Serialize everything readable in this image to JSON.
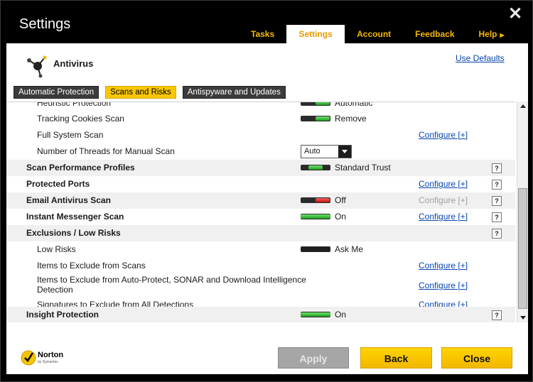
{
  "window": {
    "title": "Settings"
  },
  "topnav": {
    "tabs": [
      {
        "label": "Tasks"
      },
      {
        "label": "Settings"
      },
      {
        "label": "Account"
      },
      {
        "label": "Feedback"
      },
      {
        "label": "Help"
      }
    ],
    "active": "Settings"
  },
  "header": {
    "section": "Antivirus",
    "use_defaults": "Use Defaults",
    "logo_icon": "antivirus-molecule-icon"
  },
  "subtabs": [
    {
      "label": "Automatic Protection"
    },
    {
      "label": "Scans and Risks"
    },
    {
      "label": "Antispyware and Updates"
    }
  ],
  "rows": [
    {
      "label": "Heuristic Protection",
      "value": "Automatic"
    },
    {
      "label": "Tracking Cookies Scan",
      "value": "Remove"
    },
    {
      "label": "Full System Scan",
      "configure": "Configure [+]"
    },
    {
      "label": "Number of Threads for Manual Scan",
      "select": "Auto"
    },
    {
      "label": "Scan Performance Profiles",
      "value": "Standard Trust",
      "help": "?"
    },
    {
      "label": "Protected Ports",
      "configure": "Configure [+]",
      "help": "?"
    },
    {
      "label": "Email Antivirus Scan",
      "value": "Off",
      "configure": "Configure [+]",
      "help": "?"
    },
    {
      "label": "Instant Messenger Scan",
      "value": "On",
      "configure": "Configure [+]",
      "help": "?"
    },
    {
      "label": "Exclusions / Low Risks",
      "help": "?"
    },
    {
      "label": "Low Risks",
      "value": "Ask Me"
    },
    {
      "label": "Items to Exclude from Scans",
      "configure": "Configure [+]"
    },
    {
      "label": "Items to Exclude from Auto-Protect, SONAR and Download Intelligence",
      "label2": "Detection",
      "configure": "Configure [+]"
    },
    {
      "label": "Signatures to Exclude from All Detections",
      "configure": "Configure [+]"
    },
    {
      "label": "Insight Protection",
      "value": "On",
      "help": "?"
    }
  ],
  "footer": {
    "brand": "Norton",
    "brand_sub": "by Symantec",
    "apply": "Apply",
    "back": "Back",
    "close": "Close"
  },
  "colors": {
    "accent": "#f5b800",
    "link": "#0645ad",
    "toggle_on": "#2fb12f",
    "toggle_off": "#d01818"
  }
}
